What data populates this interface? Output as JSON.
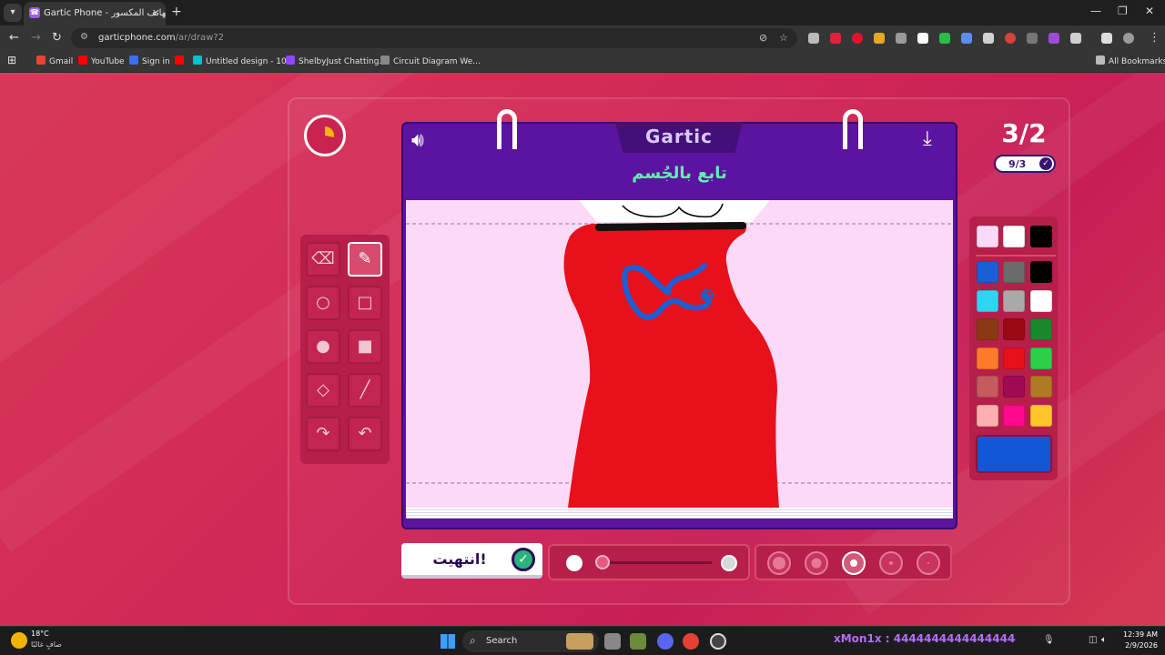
{
  "browser": {
    "tab_title": "Gartic Phone - الهاتف المكسور",
    "tab_close": "×",
    "new_tab": "+",
    "url_host": "garticphone.com",
    "url_path": "/ar/draw?2",
    "bookmarks": [
      {
        "label": "Gmail",
        "color": "#ea4335"
      },
      {
        "label": "YouTube",
        "color": "#ff0000"
      },
      {
        "label": "Sign in",
        "color": "#3b6ef5"
      },
      {
        "label": "",
        "color": "#ff0000"
      },
      {
        "label": "Untitled design - 10...",
        "color": "#00c4cc"
      },
      {
        "label": "ShelbyJust Chatting...",
        "color": "#9146ff"
      },
      {
        "label": "Circuit Diagram We...",
        "color": "#888888"
      }
    ],
    "all_bookmarks": "All Bookmarks"
  },
  "game": {
    "round_big": "3/2",
    "round_small": "9/3",
    "logo": "Gartic",
    "prompt": "تابع بالجُسم",
    "done_label": "انتهيت!",
    "timer_fraction": 0.28,
    "tools": [
      {
        "name": "eraser-tool",
        "icon": "eraser-icon",
        "glyph": "⌫",
        "active": false
      },
      {
        "name": "pen-tool",
        "icon": "pen-icon",
        "glyph": "✎",
        "active": true
      },
      {
        "name": "ellipse-outline-tool",
        "icon": "circle-outline-icon",
        "glyph": "○",
        "active": false
      },
      {
        "name": "rect-outline-tool",
        "icon": "square-outline-icon",
        "glyph": "□",
        "active": false
      },
      {
        "name": "ellipse-fill-tool",
        "icon": "circle-fill-icon",
        "glyph": "●",
        "active": false
      },
      {
        "name": "rect-fill-tool",
        "icon": "square-fill-icon",
        "glyph": "■",
        "active": false
      },
      {
        "name": "fill-bucket-tool",
        "icon": "bucket-icon",
        "glyph": "◇",
        "active": false
      },
      {
        "name": "line-tool",
        "icon": "line-icon",
        "glyph": "╱",
        "active": false
      },
      {
        "name": "redo-tool",
        "icon": "redo-icon",
        "glyph": "↷",
        "active": false
      },
      {
        "name": "undo-tool",
        "icon": "undo-icon",
        "glyph": "↶",
        "active": false
      }
    ],
    "palette_top": [
      "#fcd9f6",
      "#ffffff",
      "#000000"
    ],
    "palette": [
      "#1a5fd6",
      "#6b6b6b",
      "#000000",
      "#2fd4f2",
      "#a9a9a9",
      "#ffffff",
      "#8a3a12",
      "#9a0a14",
      "#17882c",
      "#ff7a2a",
      "#e8101a",
      "#2ccf4a",
      "#c55a5f",
      "#a00a52",
      "#b07a22",
      "#ffb0ae",
      "#ff0a8c",
      "#ffc62a"
    ],
    "current_color": "#1257d6",
    "opacity_level": 0.05,
    "brush_sizes_active": 2
  },
  "taskbar": {
    "temp": "18°C",
    "condition": "صافٍ غالبًا",
    "search": "Search",
    "stream_text": "xMon1x : 4444444444444444444",
    "time": "12:39 AM",
    "date": "2/9/2026"
  }
}
